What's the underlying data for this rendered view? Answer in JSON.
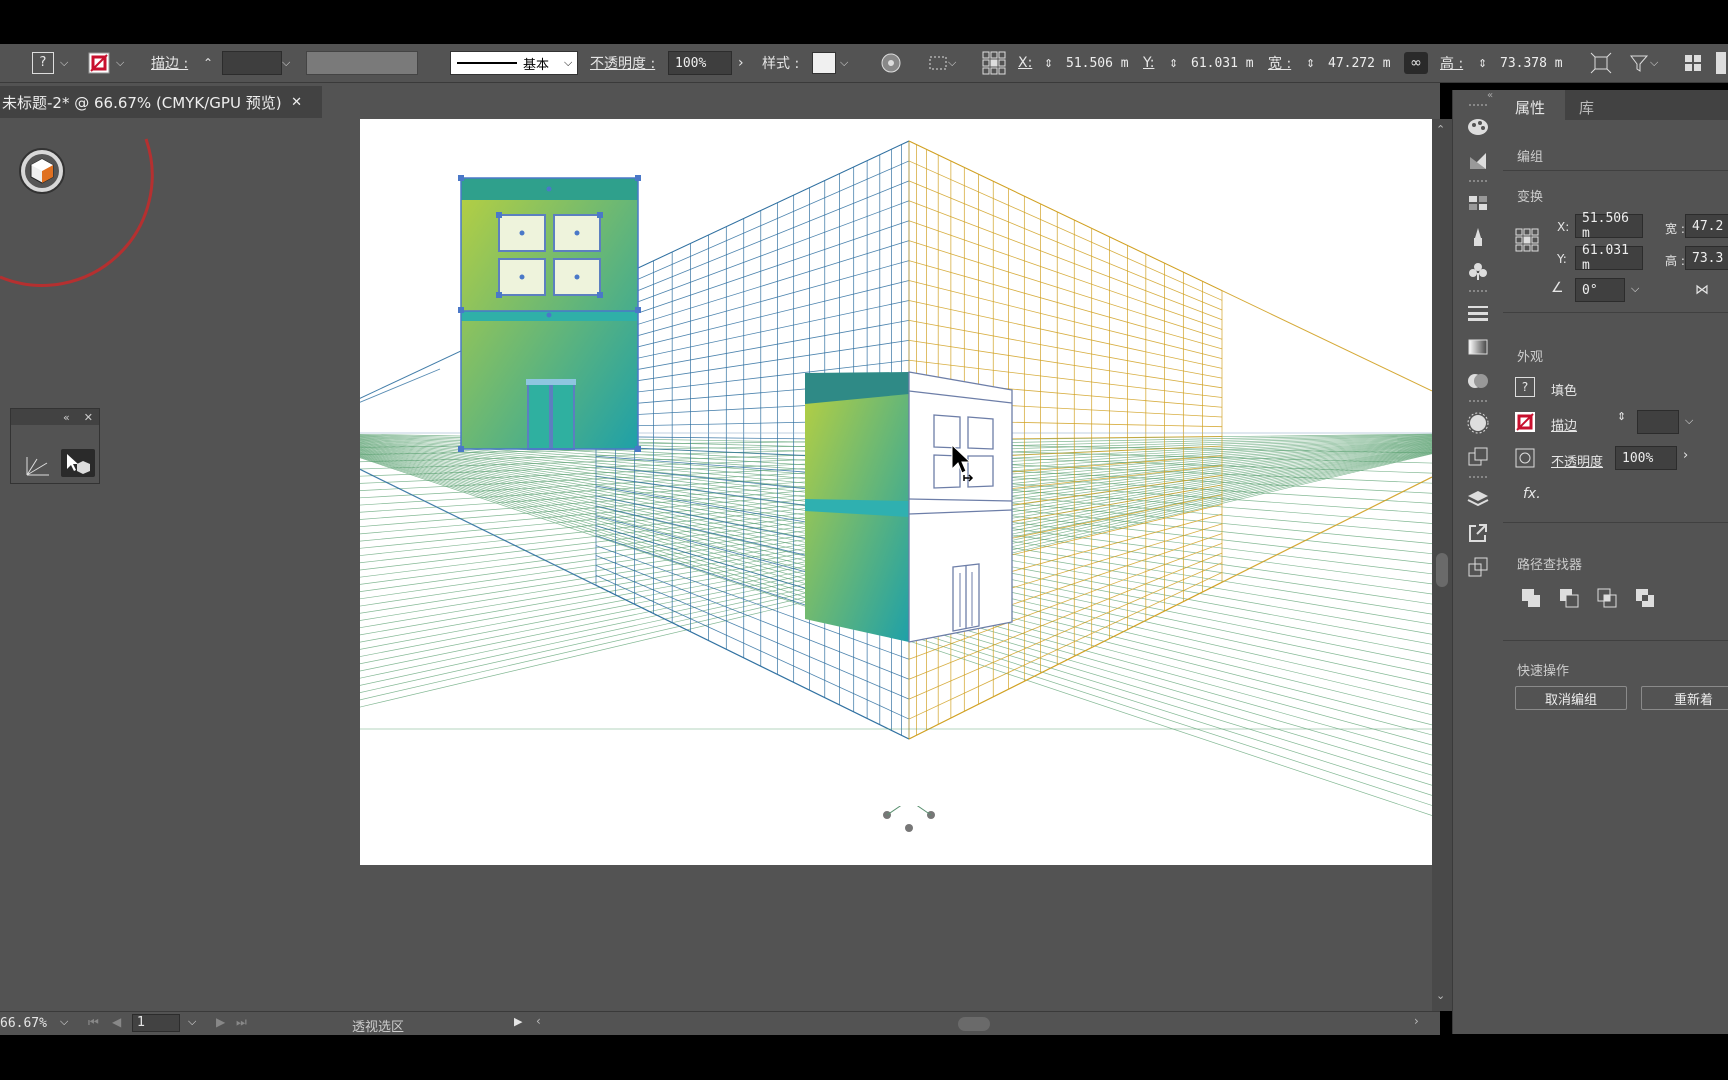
{
  "control_bar": {
    "stroke_label": "描边 :",
    "stroke_style": "基本",
    "opacity_label": "不透明度 :",
    "opacity_value": "100%",
    "style_label": "样式 :",
    "x_label": "X:",
    "x_value": "51.506 m",
    "y_label": "Y:",
    "y_value": "61.031 m",
    "w_label": "宽 :",
    "w_value": "47.272 m",
    "h_label": "高 :",
    "h_value": "73.378 m",
    "fill_indicator": "?"
  },
  "document_tab": {
    "title": "未标题-2* @ 66.67% (CMYK/GPU 预览)",
    "close": "✕"
  },
  "properties_panel": {
    "tab_properties": "属性",
    "tab_library": "库",
    "group_label": "编组",
    "transform_title": "变换",
    "x_label": "X:",
    "x_value": "51.506 m",
    "y_label": "Y:",
    "y_value": "61.031 m",
    "w_label": "宽 :",
    "w_value": "47.2",
    "h_label": "高 :",
    "h_value": "73.3",
    "angle_value": "0°",
    "appearance_title": "外观",
    "fill_label": "填色",
    "fill_indicator": "?",
    "stroke_label": "描边",
    "opacity_label": "不透明度",
    "opacity_value": "100%",
    "fx_label": "fx.",
    "pathfinder_title": "路径查找器",
    "quick_actions_title": "快速操作",
    "ungroup_button": "取消编组",
    "reset_button": "重新着"
  },
  "status_bar": {
    "zoom": "66.67%",
    "page": "1",
    "tool_name": "透视选区"
  },
  "colors": {
    "workspace": "#535353",
    "left_grid": "#2e6fa0",
    "right_grid": "#d0a020",
    "ground_grid": "#5aa070",
    "building_green": "#b8d040",
    "building_teal": "#1ea0a8"
  }
}
